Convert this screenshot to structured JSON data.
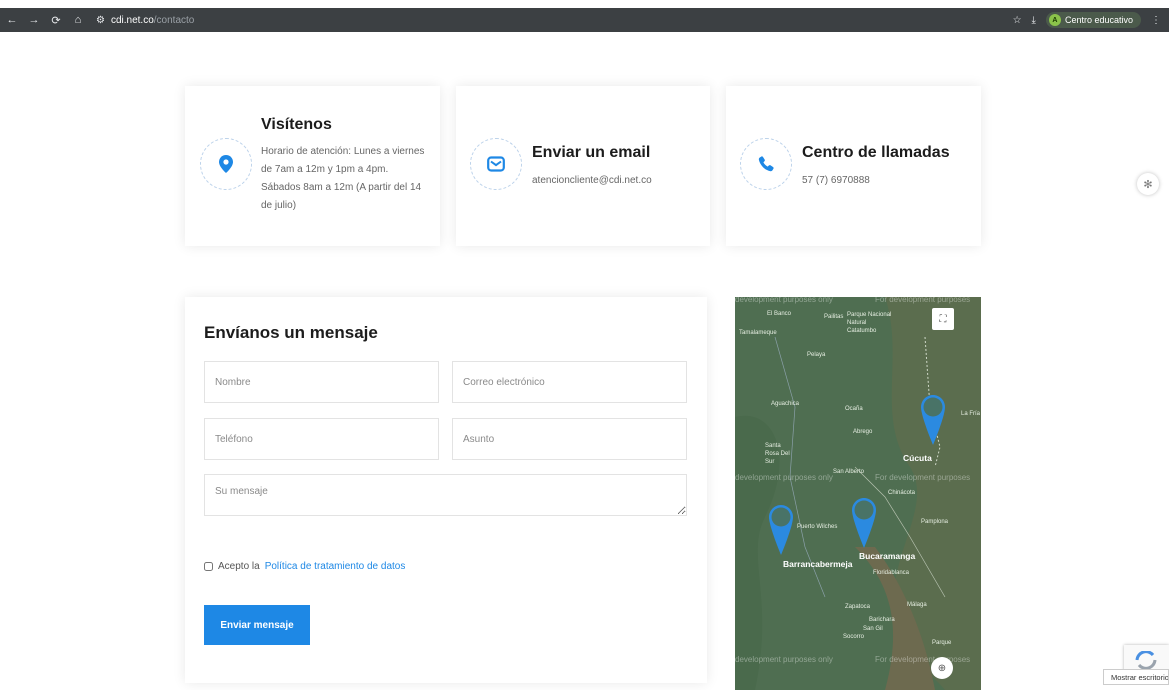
{
  "browser": {
    "url_host": "cdi.net.co",
    "url_path": "/contacto",
    "profile_initial": "A",
    "profile_name": "Centro educativo"
  },
  "cards": [
    {
      "title": "Visítenos",
      "lines": [
        "Horario de atención: Lunes a viernes",
        "de 7am a 12m y 1pm a 4pm.",
        "Sábados 8am a 12m (A partir del 14",
        "de julio)"
      ],
      "icon": "location-pin-icon"
    },
    {
      "title": "Enviar un email",
      "text": "atencioncliente@cdi.net.co",
      "icon": "envelope-icon"
    },
    {
      "title": "Centro de llamadas",
      "text": "57 (7) 6970888",
      "icon": "phone-icon"
    }
  ],
  "form": {
    "title": "Envíanos un mensaje",
    "name_placeholder": "Nombre",
    "email_placeholder": "Correo electrónico",
    "phone_placeholder": "Teléfono",
    "subject_placeholder": "Asunto",
    "message_placeholder": "Su mensaje",
    "accept_text": "Acepto la",
    "policy_link": "Política de tratamiento de datos",
    "submit_label": "Enviar mensaje"
  },
  "map": {
    "watermark": "development purposes only",
    "watermark_alt": "For development purposes",
    "labels": [
      "El Banco",
      "Pailitas",
      "Parque Nacional Natural Catatumbo",
      "Tamalameque",
      "Pelaya",
      "Aguachica",
      "Ocaña",
      "Abrego",
      "Santa Rosa Del Sur",
      "San Alberto",
      "Chinácota",
      "Pamplona",
      "Puerto Wilches",
      "Floridablanca",
      "Zapatoca",
      "Málaga",
      "Barichara",
      "San Gil",
      "Socorro",
      "Parque",
      "La Fría"
    ],
    "cities": [
      "Cúcuta",
      "Bucaramanga",
      "Barrancabermeja"
    ],
    "colors": {
      "pin": "#2b8ae0",
      "terrain": "#4f6e51"
    }
  },
  "tooltip": "Mostrar escritorio",
  "colors": {
    "accent": "#1e88e5",
    "bar": "#3c4043"
  }
}
